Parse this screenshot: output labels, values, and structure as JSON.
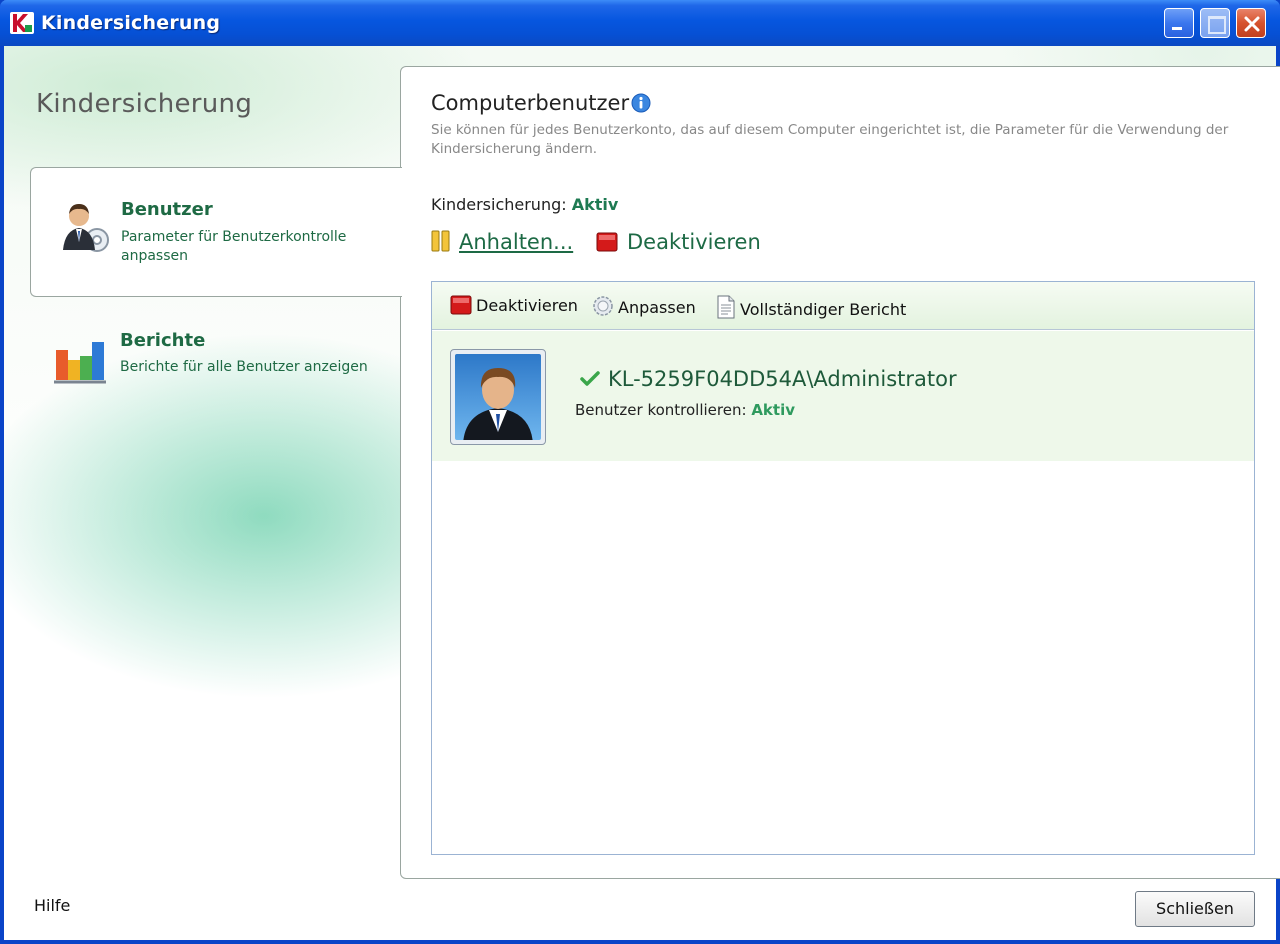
{
  "window": {
    "title": "Kindersicherung",
    "accent_color": "#0656df",
    "controls": [
      "minimize-icon",
      "maximize-icon",
      "close-icon"
    ]
  },
  "sidebar": {
    "title": "Kindersicherung",
    "items": [
      {
        "heading": "Benutzer",
        "description": "Parameter für Benutzerkontrolle anpassen",
        "icon": "user-settings-icon",
        "active": true
      },
      {
        "heading": "Berichte",
        "description": "Berichte für alle Benutzer anzeigen",
        "icon": "bar-chart-icon",
        "active": false
      }
    ],
    "help_label": "Hilfe"
  },
  "main": {
    "title": "Computerbenutzer",
    "description": "Sie können für jedes Benutzerkonto, das auf diesem Computer eingerichtet ist, die Parameter für die Verwendung der Kindersicherung ändern.",
    "status_label": "Kindersicherung:",
    "status_value": "Aktiv",
    "pause_label": "Anhalten...",
    "deactivate_label": "Deaktivieren",
    "toolbar": {
      "deactivate_label": "Deaktivieren",
      "customize_label": "Anpassen",
      "report_label": "Vollständiger Bericht"
    },
    "users": [
      {
        "name": "KL-5259F04DD54A\\Administrator",
        "control_label": "Benutzer kontrollieren:",
        "control_value": "Aktiv"
      }
    ],
    "status_color": "#1e7a52"
  },
  "footer": {
    "close_label": "Schließen"
  }
}
